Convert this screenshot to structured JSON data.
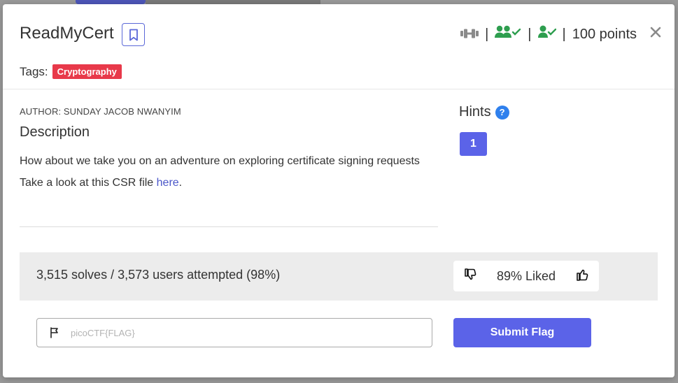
{
  "challenge": {
    "title": "ReadMyCert",
    "points": "100 points",
    "tags_label": "Tags:",
    "tag": "Cryptography",
    "author": "AUTHOR: SUNDAY JACOB NWANYIM",
    "description_heading": "Description",
    "description_line1": "How about we take you on an adventure on exploring certificate signing requests",
    "description_line2_prefix": "Take a look at this CSR file ",
    "description_link": "here",
    "description_line2_suffix": "."
  },
  "meta_icons": {
    "difficulty": "dumbbell-icon",
    "team_solved": "users-check-icon",
    "user_solved": "user-check-icon",
    "separator": "|"
  },
  "hints": {
    "heading": "Hints",
    "help_glyph": "?",
    "items": [
      "1"
    ]
  },
  "stats": {
    "solves_text": "3,515 solves / 3,573 users attempted (98%)",
    "liked_text": "89% Liked"
  },
  "flag_form": {
    "placeholder": "picoCTF{FLAG}",
    "submit_label": "Submit Flag"
  },
  "colors": {
    "accent": "#5b63e8",
    "tag": "#e8394a",
    "solved_green": "#2e9e4f",
    "hint_blue": "#2f80ed"
  }
}
